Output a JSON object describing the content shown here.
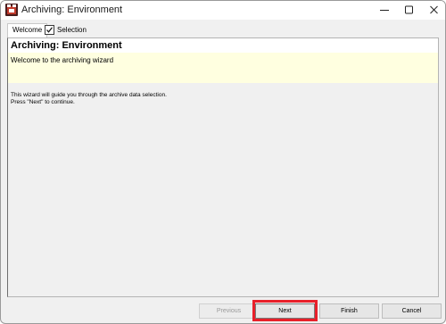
{
  "window": {
    "title": "Archiving: Environment"
  },
  "tabs": {
    "welcome_label": "Welcome",
    "selection_label": "Selection",
    "selection_checked": true
  },
  "content": {
    "title": "Archiving: Environment",
    "subtitle": "Welcome to the archiving wizard",
    "description_line1": "This wizard will guide you through the archive data selection.",
    "description_line2": "Press \"Next\" to continue."
  },
  "buttons": {
    "previous_label": "Previous",
    "next_label": "Next",
    "finish_label": "Finish",
    "cancel_label": "Cancel",
    "previous_enabled": false
  },
  "colors": {
    "highlight": "#e8202a",
    "header_background": "#ffffe0"
  },
  "icons": {
    "app": "archive-app-icon",
    "minimize": "minimize-icon",
    "maximize": "maximize-icon",
    "close": "close-icon",
    "checkbox": "checkmark-icon"
  }
}
